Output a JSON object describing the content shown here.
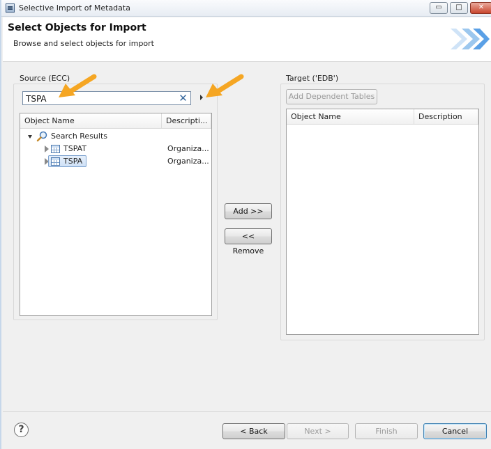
{
  "window": {
    "title": "Selective Import of Metadata",
    "buttons": {
      "minimize": "▭",
      "maximize": "□",
      "close": "✕"
    }
  },
  "header": {
    "title": "Select Objects for Import",
    "subtitle": "Browse and select objects for import"
  },
  "source": {
    "label": "Source (ECC)",
    "search_value": "TSPA",
    "columns": [
      "Object Name",
      "Descripti..."
    ],
    "tree": {
      "root_label": "Search Results",
      "items": [
        {
          "name": "TSPAT",
          "description": "Organiza...",
          "selected": false
        },
        {
          "name": "TSPA",
          "description": "Organiza...",
          "selected": true
        }
      ]
    }
  },
  "actions": {
    "add_label": "Add >>",
    "remove_label": "<< Remove"
  },
  "target": {
    "label": "Target ('EDB')",
    "add_dependent_label": "Add Dependent Tables",
    "columns": [
      "Object Name",
      "Description"
    ]
  },
  "footer": {
    "help": "?",
    "back_label": "< Back",
    "next_label": "Next >",
    "finish_label": "Finish",
    "cancel_label": "Cancel"
  },
  "colors": {
    "annotation_arrow": "#f5a623",
    "selection_fill": "#d5e6f7",
    "banner_arrow": "#5aa0e6"
  }
}
